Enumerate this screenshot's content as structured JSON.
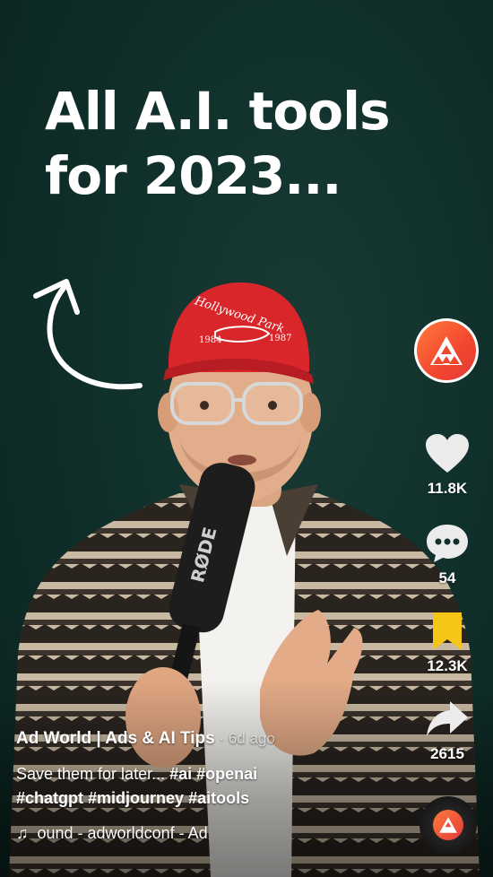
{
  "video": {
    "headline": "All A.I. tools for 2023...",
    "mic_brand": "RØDE",
    "cap_text": "Hollywood Park"
  },
  "rail": {
    "likes": "11.8K",
    "comments": "54",
    "saves": "12.3K",
    "shares": "2615"
  },
  "caption": {
    "author": "Ad World | Ads & AI Tips",
    "separator": " · ",
    "time": "6d ago",
    "text": "Save them for later...",
    "hashtags": [
      "#ai",
      "#openai",
      "#chatgpt",
      "#midjourney",
      "#aitools"
    ],
    "sound": "ound - adworldconf - Ad"
  },
  "colors": {
    "background": "#10302b",
    "save_active": "#f5c518",
    "avatar_orange": "#f2462e"
  },
  "icons": {
    "like": "heart-icon",
    "comment": "comment-bubble-icon",
    "save": "bookmark-icon",
    "share": "share-arrow-icon",
    "sound": "music-note-icon"
  }
}
